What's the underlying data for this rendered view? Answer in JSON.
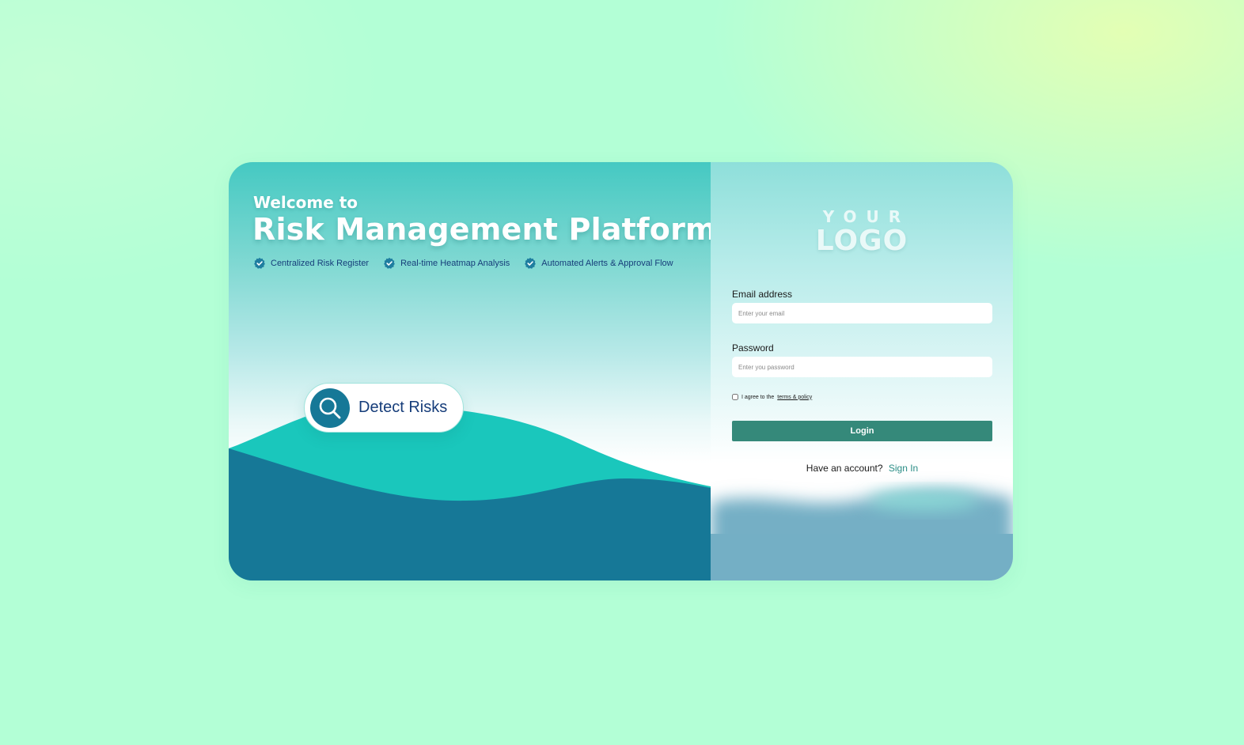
{
  "hero": {
    "welcome": "Welcome to",
    "title": "Risk Management Platform",
    "features": [
      {
        "label": "Centralized Risk Register",
        "icon": "verified-check-icon"
      },
      {
        "label": "Real-time Heatmap Analysis",
        "icon": "verified-check-icon"
      },
      {
        "label": "Automated Alerts & Approval Flow",
        "icon": "verified-check-icon"
      }
    ],
    "detect_button": {
      "label": "Detect Risks",
      "icon": "search-icon"
    }
  },
  "logo": {
    "line1": "YOUR",
    "line2": "LOGO"
  },
  "form": {
    "email": {
      "label": "Email address",
      "placeholder": "Enter your email",
      "value": ""
    },
    "password": {
      "label": "Password",
      "placeholder": "Enter you password",
      "value": ""
    },
    "agree": {
      "prefix": "I agree to the",
      "link": "terms & policy",
      "checked": false
    },
    "login_label": "Login",
    "account": {
      "question": "Have an account?",
      "link": "Sign In"
    }
  },
  "colors": {
    "teal_primary": "#45c9c2",
    "wave_light": "#1ac7bc",
    "wave_dark": "#167897",
    "heading_navy": "#163d7a",
    "login_button": "#35897a",
    "link_teal": "#2a8d86",
    "page_bg": "#b3ffd6"
  }
}
